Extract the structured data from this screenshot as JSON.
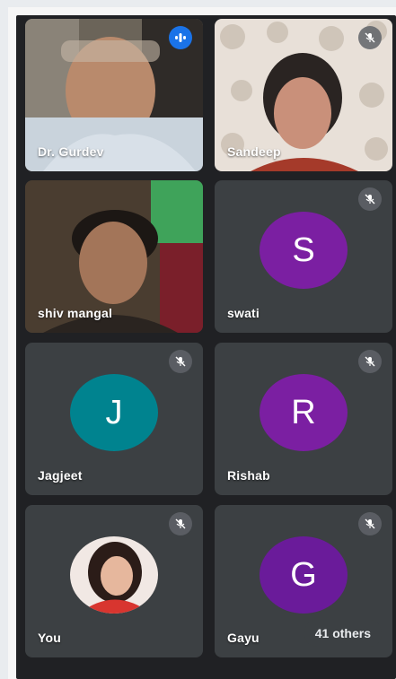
{
  "participants": [
    {
      "name": "Dr. Gurdev",
      "status": "speaking"
    },
    {
      "name": "Sandeep",
      "status": "muted"
    },
    {
      "name": "shiv mangal",
      "status": "unmuted"
    },
    {
      "name": "swati",
      "initial": "S",
      "color": "#7b1fa2",
      "status": "muted"
    },
    {
      "name": "Jagjeet",
      "initial": "J",
      "color": "#00838f",
      "status": "muted"
    },
    {
      "name": "Rishab",
      "initial": "R",
      "color": "#7b1fa2",
      "status": "muted"
    },
    {
      "name": "You",
      "status": "muted"
    },
    {
      "name": "Gayu",
      "initial": "G",
      "color": "#6a1b9a",
      "status": "muted"
    }
  ],
  "others_chip": {
    "label": "41 others"
  }
}
